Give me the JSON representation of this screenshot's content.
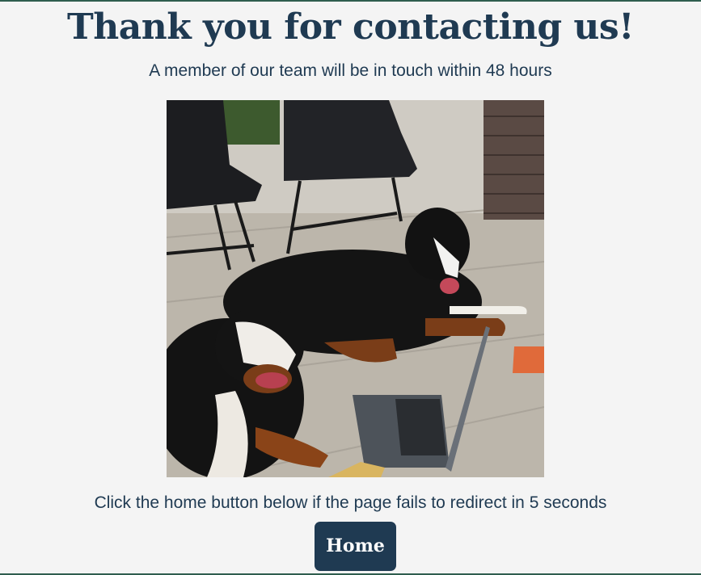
{
  "header": {
    "title": "Thank you for contacting us!",
    "subtitle": "A member of our team will be in touch within 48 hours"
  },
  "main": {
    "image_subject": "two dogs lying near chairs and a laptop",
    "notice": "Click the home button below if the page fails to redirect in 5 seconds",
    "home_button_label": "Home"
  },
  "colors": {
    "primary": "#1f3a52",
    "background": "#f4f4f4",
    "accent_rule": "#2f5e4e"
  }
}
